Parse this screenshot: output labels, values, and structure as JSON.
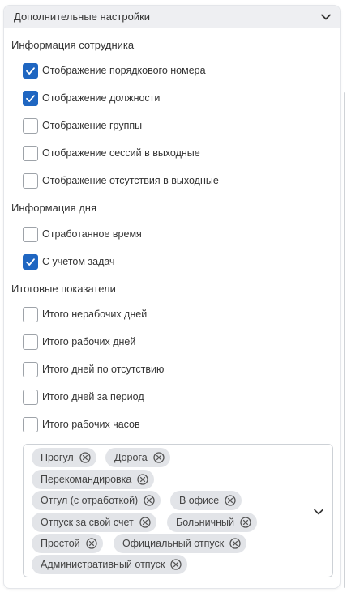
{
  "header": {
    "title": "Дополнительные настройки",
    "chevron_icon": "chevron-down-icon"
  },
  "sections": {
    "employee_info": {
      "title": "Информация сотрудника",
      "options": [
        {
          "label": "Отображение порядкового номера",
          "checked": true
        },
        {
          "label": "Отображение должности",
          "checked": true
        },
        {
          "label": "Отображение группы",
          "checked": false
        },
        {
          "label": "Отображение сессий в выходные",
          "checked": false
        },
        {
          "label": "Отображение отсутствия в выходные",
          "checked": false
        }
      ]
    },
    "day_info": {
      "title": "Информация дня",
      "options": [
        {
          "label": "Отработанное время",
          "checked": false
        },
        {
          "label": "С учетом задач",
          "checked": true
        }
      ]
    },
    "totals": {
      "title": "Итоговые показатели",
      "options": [
        {
          "label": "Итого нерабочих дней",
          "checked": false
        },
        {
          "label": "Итого рабочих дней",
          "checked": false
        },
        {
          "label": "Итого дней по отсутствию",
          "checked": false
        },
        {
          "label": "Итого дней за период",
          "checked": false
        },
        {
          "label": "Итого рабочих часов",
          "checked": false
        }
      ]
    }
  },
  "absence_select": {
    "chips": [
      "Прогул",
      "Дорога",
      "Перекомандировка",
      "Отгул (с отработкой)",
      "В офисе",
      "Отпуск за свой счет",
      "Больничный",
      "Простой",
      "Официальный отпуск",
      "Административный отпуск"
    ]
  },
  "colors": {
    "accent": "#1f66c1",
    "chip_bg": "#e2e4e8",
    "header_bg": "#eeeff2"
  }
}
